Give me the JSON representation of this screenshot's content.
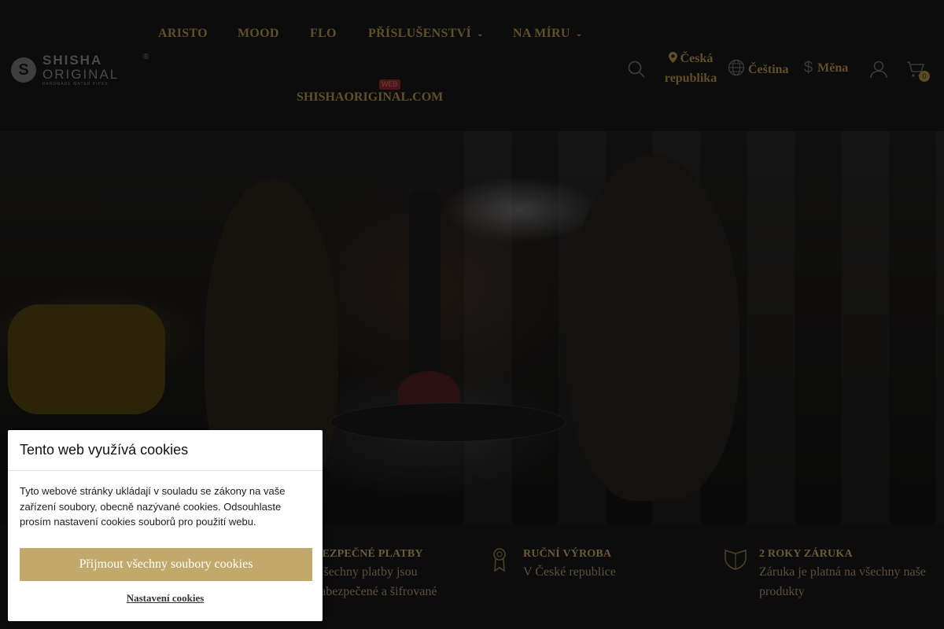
{
  "header": {
    "logo": {
      "line1": "SHISHA",
      "line2": "ORIGINAL",
      "tagline": "HANDMADE WATER PIPES",
      "reg": "®"
    },
    "nav": [
      {
        "label": "ARISTO",
        "has_dropdown": false
      },
      {
        "label": "MOOD",
        "has_dropdown": false
      },
      {
        "label": "FLO",
        "has_dropdown": false
      },
      {
        "label": "PŘÍSLUŠENSTVÍ",
        "has_dropdown": true
      },
      {
        "label": "NA MÍRU",
        "has_dropdown": true
      },
      {
        "label": "SHISHAORIGINAL.COM",
        "badge": "WEB"
      }
    ],
    "country": "Česká republika",
    "language": "Čeština",
    "currency": "Měna",
    "cart_count": "0",
    "icons": [
      "search-icon",
      "map-pin-icon",
      "globe-icon",
      "dollar-icon",
      "user-icon",
      "cart-icon",
      "chevron-down-icon"
    ]
  },
  "features": [
    {
      "title": "BEZPEČNÉ PLATBY",
      "text": "Všechny platby jsou zabezpečené a šifrované",
      "icon": "lock-icon"
    },
    {
      "title": "RUČNÍ VÝROBA",
      "text": "V České republice",
      "icon": "award-icon"
    },
    {
      "title": "2 ROKY ZÁRUKA",
      "text": "Záruka je platná na všechny naše produkty",
      "icon": "shield-icon"
    }
  ],
  "cookie": {
    "title": "Tento web využívá cookies",
    "body": "Tyto webové stránky ukládají v souladu se zákony na vaše zařízení soubory, obecně nazývané cookies. Odsouhlaste prosím nastavení cookies souborů pro použití webu.",
    "accept_label": "Přijmout všechny soubory cookies",
    "settings_label": "Nastavení cookies"
  },
  "colors": {
    "accent": "#c2a86a",
    "nav_dimmed": "#615027",
    "background": "#0c0c0c"
  }
}
